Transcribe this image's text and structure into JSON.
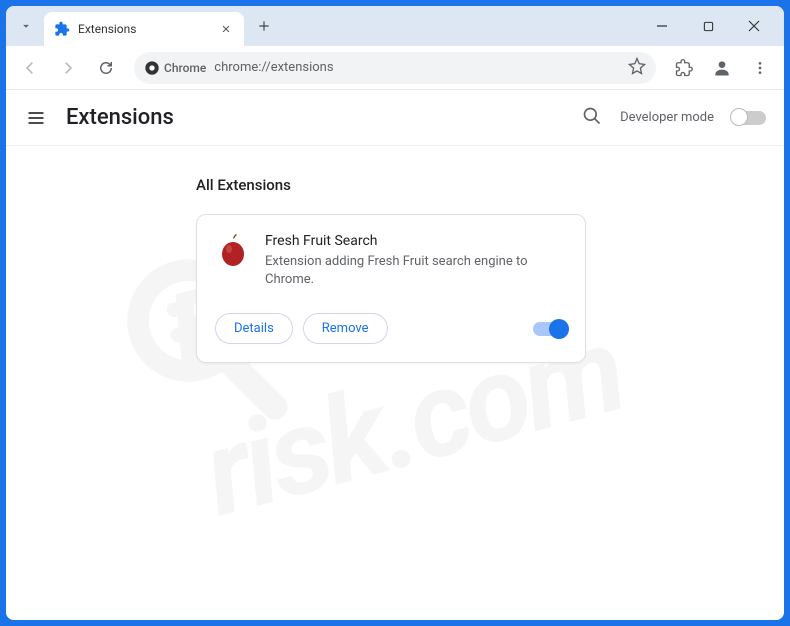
{
  "tab": {
    "title": "Extensions"
  },
  "omnibox": {
    "label": "Chrome",
    "url": "chrome://extensions"
  },
  "header": {
    "title": "Extensions",
    "dev_mode_label": "Developer mode"
  },
  "section": {
    "title": "All Extensions"
  },
  "extension": {
    "name": "Fresh Fruit Search",
    "description": "Extension adding Fresh Fruit search engine to Chrome.",
    "details_label": "Details",
    "remove_label": "Remove",
    "enabled": true
  },
  "watermark": {
    "top": "PC",
    "bottom": "risk.com"
  }
}
